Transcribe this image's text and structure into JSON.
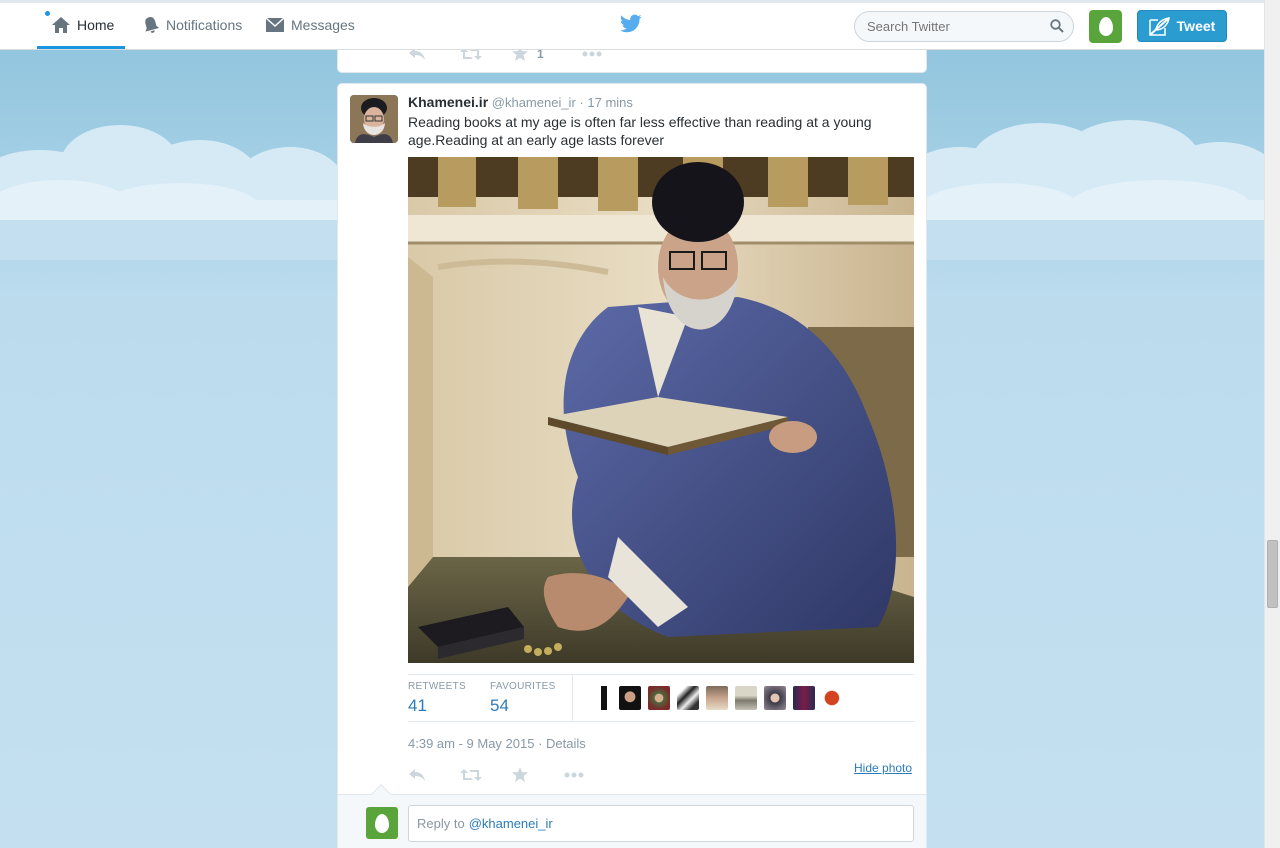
{
  "nav": {
    "home_label": "Home",
    "notifications_label": "Notifications",
    "messages_label": "Messages",
    "search_placeholder": "Search Twitter",
    "tweet_button_label": "Tweet"
  },
  "colors": {
    "accent": "#2b9ccf",
    "link": "#2b7bb9",
    "egg_avatar": "#5aa43c",
    "background_sky": "#9ccbe2"
  },
  "previous_tweet": {
    "favourite_count": "1"
  },
  "tweet": {
    "name": "Khamenei.ir",
    "handle": "@khamenei_ir",
    "separator": "·",
    "time_ago": "17 mins",
    "text": "Reading books at my age is often far less effective than reading at a young age.Reading at an early age lasts forever",
    "retweets_label": "RETWEETS",
    "retweets": "41",
    "favourites_label": "FAVOURITES",
    "favourites": "54",
    "timestamp": "4:39 am - 9 May 2015",
    "timestamp_sep": " · ",
    "details_label": "Details",
    "hide_photo_label": "Hide photo"
  },
  "reply": {
    "prefix": "Reply to",
    "mention": "@khamenei_ir"
  },
  "icons": [
    "home-icon",
    "bell-icon",
    "envelope-icon",
    "twitter-bird-icon",
    "search-icon",
    "compose-quill-icon",
    "reply-icon",
    "retweet-icon",
    "star-icon",
    "more-icon"
  ]
}
